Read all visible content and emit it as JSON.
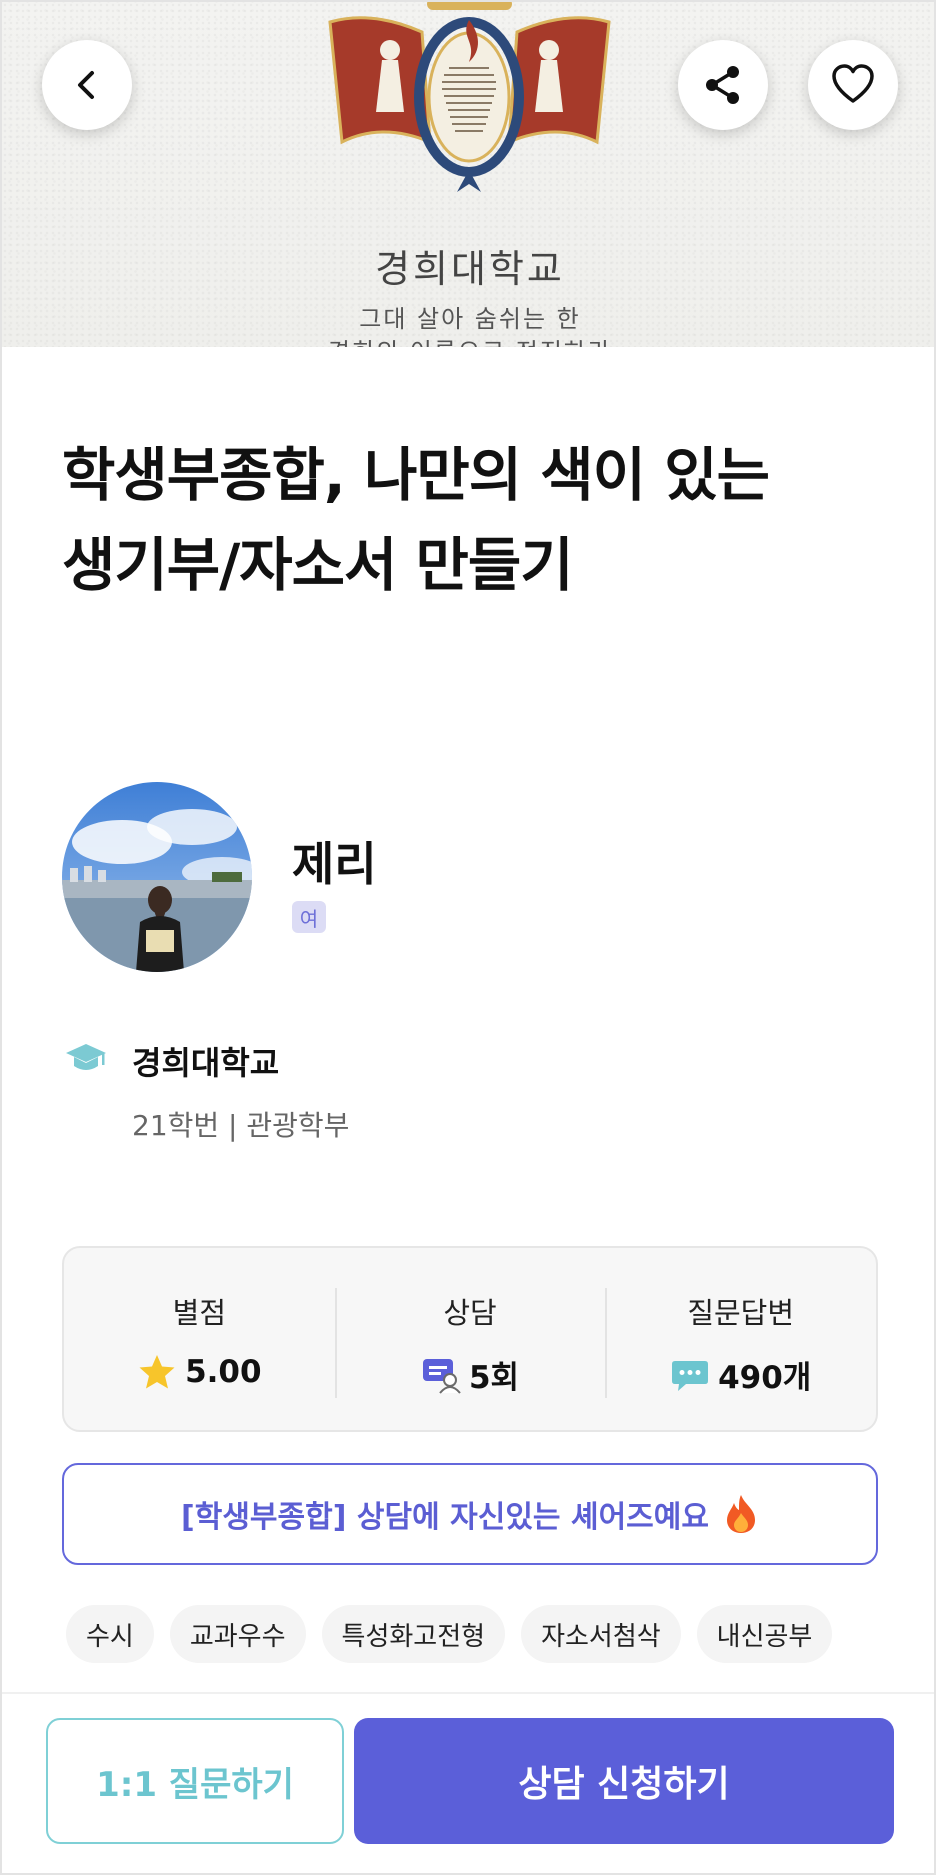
{
  "banner": {
    "university_title": "경희대학교",
    "motto_line1": "그대 살아 숨쉬는 한",
    "motto_line2": "경희의 이름으로 정진하라",
    "emblem_text": "The World is a Global Village and the Peoples of the World are One Human Family. May We Strive for Peace and Humanity with the Spirit of Global Cooperation Society"
  },
  "header": {
    "back_icon": "chevron-left-icon",
    "share_icon": "share-icon",
    "favorite_icon": "heart-outline-icon"
  },
  "title": {
    "line1": "학생부종합, 나만의 색이 있는",
    "line2": "생기부/자소서 만들기"
  },
  "mentor": {
    "name": "제리",
    "gender": "여",
    "school": "경희대학교",
    "detail": "21학번 | 관광학부"
  },
  "stats": [
    {
      "label": "별점",
      "value": "5.00",
      "icon": "star-icon"
    },
    {
      "label": "상담",
      "value": "5회",
      "icon": "consult-icon"
    },
    {
      "label": "질문답변",
      "value": "490개",
      "icon": "chat-bubble-icon"
    }
  ],
  "highlight": {
    "text": "[학생부종합] 상담에 자신있는 셰어즈예요",
    "emoji": "🔥"
  },
  "tags": [
    "수시",
    "교과우수",
    "특성화고전형",
    "자소서첨삭",
    "내신공부"
  ],
  "actions": {
    "question_label": "1:1 질문하기",
    "apply_label": "상담 신청하기"
  },
  "colors": {
    "primary": "#5b5fd9",
    "accent_teal": "#6cc5cf",
    "star": "#f7c52b",
    "emblem_red": "#a63a2a"
  }
}
